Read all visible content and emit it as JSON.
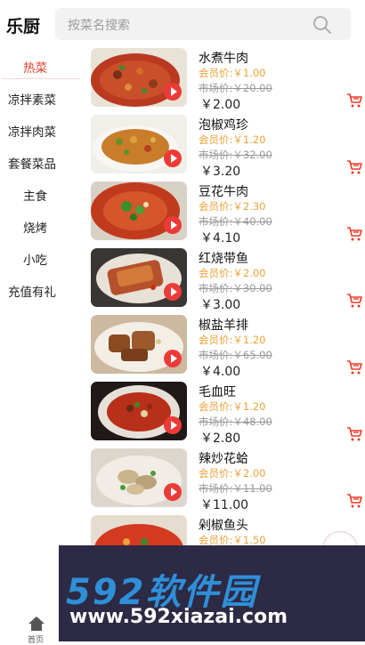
{
  "header": {
    "title": "乐厨",
    "search_placeholder": "按菜名搜索"
  },
  "sidebar": {
    "items": [
      {
        "label": "热菜"
      },
      {
        "label": "凉拌素菜"
      },
      {
        "label": "凉拌肉菜"
      },
      {
        "label": "套餐菜品"
      },
      {
        "label": "主食"
      },
      {
        "label": "烧烤"
      },
      {
        "label": "小吃"
      },
      {
        "label": "充值有礼"
      }
    ]
  },
  "dishes": [
    {
      "name": "水煮牛肉",
      "member": "会员价:￥1.00",
      "market": "市场价:￥20.00",
      "price": "￥2.00"
    },
    {
      "name": "泡椒鸡珍",
      "member": "会员价:￥1.20",
      "market": "市场价:￥32.00",
      "price": "￥3.20"
    },
    {
      "name": "豆花牛肉",
      "member": "会员价:￥2.30",
      "market": "市场价:￥40.00",
      "price": "￥4.10"
    },
    {
      "name": "红烧带鱼",
      "member": "会员价:￥2.00",
      "market": "市场价:￥30.00",
      "price": "￥3.00"
    },
    {
      "name": "椒盐羊排",
      "member": "会员价:￥1.20",
      "market": "市场价:￥65.00",
      "price": "￥4.00"
    },
    {
      "name": "毛血旺",
      "member": "会员价:￥1.20",
      "market": "市场价:￥48.00",
      "price": "￥2.80"
    },
    {
      "name": "辣炒花蛤",
      "member": "会员价:￥2.00",
      "market": "市场价:￥11.00",
      "price": "￥11.00"
    },
    {
      "name": "剁椒鱼头",
      "member": "会员价:￥1.50",
      "market": "",
      "price": ""
    }
  ],
  "tabbar": {
    "home_label": "首页"
  },
  "ad": {
    "logo": "592软件园",
    "url": "www.592xiazai.com"
  },
  "colors": {
    "accent": "#ee3b2a",
    "member": "#e9a33b",
    "play": "#ec3b37"
  },
  "icons": {
    "search": "search-icon",
    "cart": "cart-icon",
    "play": "play-icon",
    "home": "home-icon"
  }
}
